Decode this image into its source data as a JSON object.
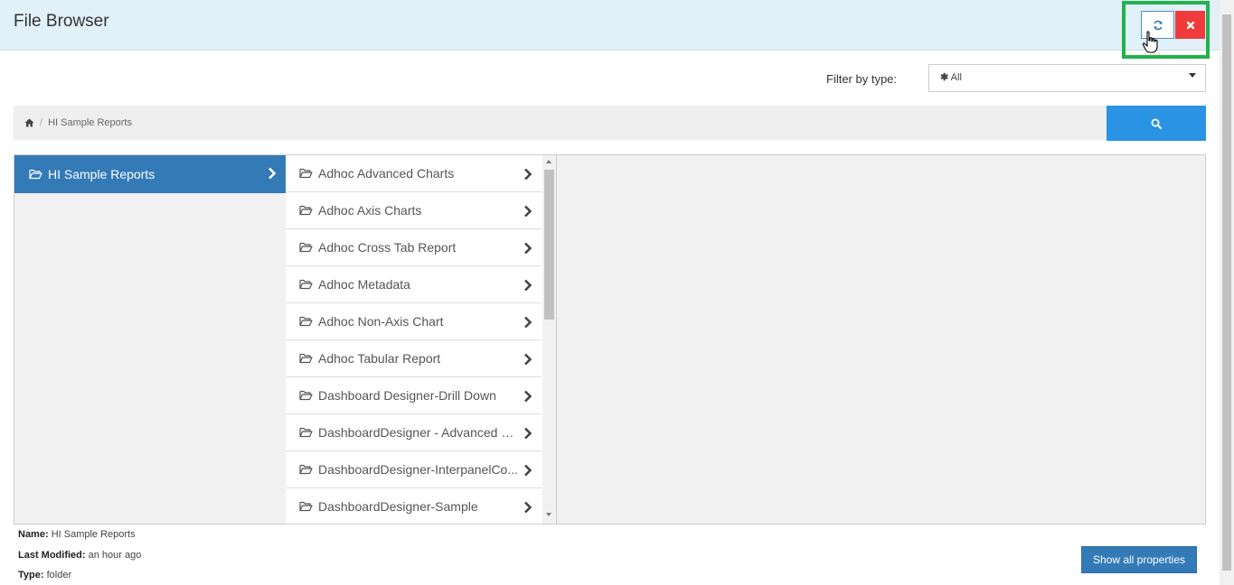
{
  "header": {
    "title": "File Browser",
    "refresh_icon": "refresh-icon",
    "close_icon": "close-icon"
  },
  "filter": {
    "label": "Filter by type:",
    "selected": "All",
    "selected_icon": "asterisk-icon"
  },
  "breadcrumb": {
    "home_icon": "home-icon",
    "separator": "/",
    "current": "HI Sample Reports"
  },
  "search": {
    "icon": "search-icon"
  },
  "columns": {
    "root": {
      "label": "HI Sample Reports"
    },
    "children": [
      {
        "label": "Adhoc Advanced Charts"
      },
      {
        "label": "Adhoc Axis Charts"
      },
      {
        "label": "Adhoc Cross Tab Report"
      },
      {
        "label": "Adhoc Metadata"
      },
      {
        "label": "Adhoc Non-Axis Chart"
      },
      {
        "label": "Adhoc Tabular Report"
      },
      {
        "label": "Dashboard Designer-Drill Down"
      },
      {
        "label": "DashboardDesigner - Advanced M..."
      },
      {
        "label": "DashboardDesigner-InterpanelCo..."
      },
      {
        "label": "DashboardDesigner-Sample"
      }
    ]
  },
  "properties": {
    "name_label": "Name:",
    "name_value": "HI Sample Reports",
    "modified_label": "Last Modified:",
    "modified_value": "an hour ago",
    "type_label": "Type:",
    "type_value": "folder",
    "show_all_label": "Show all properties"
  },
  "colors": {
    "header_bg": "#e1f0f9",
    "primary": "#337ab7",
    "search_blue": "#2a93e3",
    "close_red": "#ef3b3b",
    "highlight_green": "#22b14c"
  }
}
